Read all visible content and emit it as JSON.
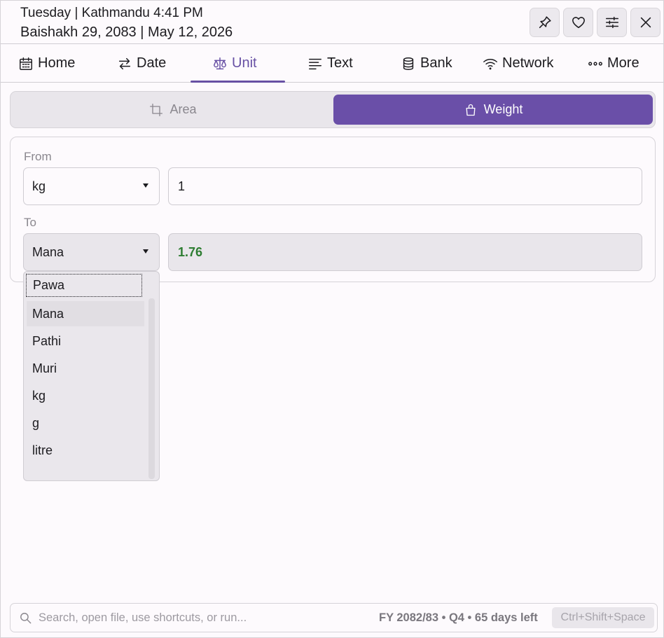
{
  "header": {
    "line1": "Tuesday | Kathmandu 4:41 PM",
    "line2": "Baishakh 29, 2083 | May 12, 2026",
    "buttons": [
      "pin-icon",
      "heart-icon",
      "sliders-icon",
      "close-icon"
    ]
  },
  "tabs": [
    {
      "label": "Home",
      "icon": "calendar-icon"
    },
    {
      "label": "Date",
      "icon": "swap-arrows-icon"
    },
    {
      "label": "Unit",
      "icon": "scale-icon",
      "active": true
    },
    {
      "label": "Text",
      "icon": "text-lines-icon"
    },
    {
      "label": "Bank",
      "icon": "database-icon"
    },
    {
      "label": "Network",
      "icon": "wifi-icon"
    },
    {
      "label": "More",
      "icon": "more-dots-icon"
    }
  ],
  "segment": {
    "area_label": "Area",
    "weight_label": "Weight",
    "selected": "Weight"
  },
  "converter": {
    "from_label": "From",
    "from_unit": "kg",
    "from_value": "1",
    "to_label": "To",
    "to_unit": "Mana",
    "to_value": "1.76"
  },
  "dropdown": {
    "options": [
      "Pawa",
      "Mana",
      "Pathi",
      "Muri",
      "kg",
      "g",
      "litre"
    ],
    "focused": "Pawa",
    "selected": "Mana"
  },
  "footer": {
    "search_placeholder": "Search, open file, use shortcuts, or run...",
    "fiscal_info": "FY 2082/83 • Q4 • 65 days left",
    "shortcut": "Ctrl+Shift+Space"
  },
  "colors": {
    "accent": "#6750a4",
    "result_text": "#2e7d32"
  }
}
